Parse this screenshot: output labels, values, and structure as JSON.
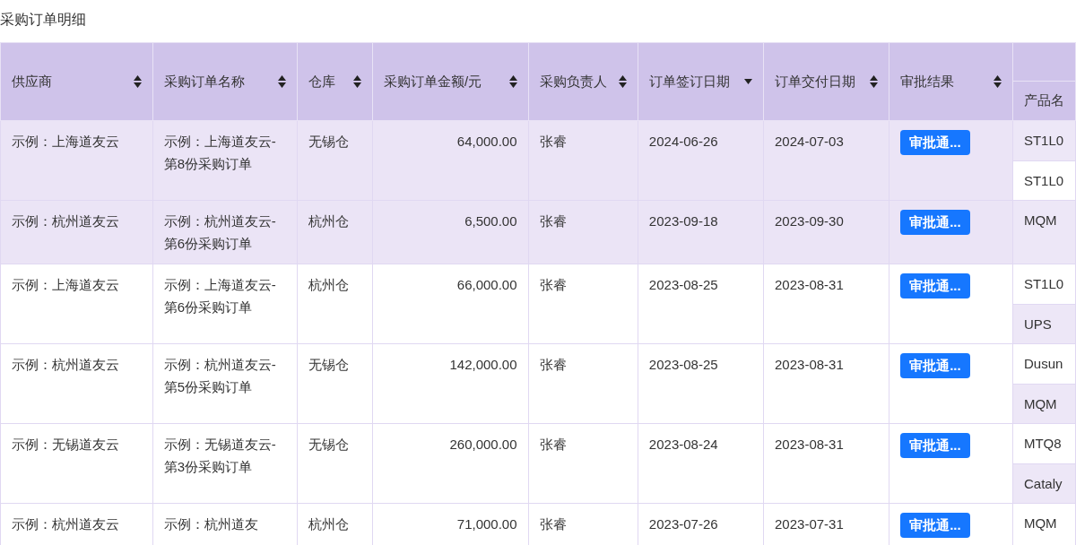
{
  "title": "采购订单明细",
  "table": {
    "columns": [
      {
        "label": "供应商",
        "sorted": false
      },
      {
        "label": "采购订单名称",
        "sorted": false
      },
      {
        "label": "仓库",
        "sorted": false
      },
      {
        "label": "采购订单金额/元",
        "sorted": false
      },
      {
        "label": "采购负责人",
        "sorted": false
      },
      {
        "label": "订单签订日期",
        "sorted": true
      },
      {
        "label": "订单交付日期",
        "sorted": false
      },
      {
        "label": "审批结果",
        "sorted": false
      }
    ],
    "product_group": {
      "subcolumns": [
        "产品名"
      ]
    },
    "rows": [
      {
        "highlighted": true,
        "supplier": "示例：上海道友云",
        "order_name": "示例：上海道友云-第8份采购订单",
        "warehouse": "无锡仓",
        "amount": "64,000.00",
        "owner": "张睿",
        "sign_date": "2024-06-26",
        "delivery_date": "2024-07-03",
        "approval": "审批通...",
        "products": [
          {
            "name": "ST1L0",
            "shaded": true
          },
          {
            "name": "ST1L0",
            "shaded": false
          }
        ]
      },
      {
        "highlighted": true,
        "supplier": "示例：杭州道友云",
        "order_name": "示例：杭州道友云-第6份采购订单",
        "warehouse": "杭州仓",
        "amount": "6,500.00",
        "owner": "张睿",
        "sign_date": "2023-09-18",
        "delivery_date": "2023-09-30",
        "approval": "审批通...",
        "products": [
          {
            "name": "MQM",
            "shaded": true
          }
        ]
      },
      {
        "highlighted": false,
        "supplier": "示例：上海道友云",
        "order_name": "示例：上海道友云-第6份采购订单",
        "warehouse": "杭州仓",
        "amount": "66,000.00",
        "owner": "张睿",
        "sign_date": "2023-08-25",
        "delivery_date": "2023-08-31",
        "approval": "审批通...",
        "products": [
          {
            "name": "ST1L0",
            "shaded": false
          },
          {
            "name": "UPS",
            "shaded": true
          }
        ]
      },
      {
        "highlighted": false,
        "supplier": "示例：杭州道友云",
        "order_name": "示例：杭州道友云-第5份采购订单",
        "warehouse": "无锡仓",
        "amount": "142,000.00",
        "owner": "张睿",
        "sign_date": "2023-08-25",
        "delivery_date": "2023-08-31",
        "approval": "审批通...",
        "products": [
          {
            "name": "Dusun",
            "shaded": false
          },
          {
            "name": "MQM",
            "shaded": true
          }
        ]
      },
      {
        "highlighted": false,
        "supplier": "示例：无锡道友云",
        "order_name": "示例：无锡道友云-第3份采购订单",
        "warehouse": "无锡仓",
        "amount": "260,000.00",
        "owner": "张睿",
        "sign_date": "2023-08-24",
        "delivery_date": "2023-08-31",
        "approval": "审批通...",
        "products": [
          {
            "name": "MTQ8",
            "shaded": false
          },
          {
            "name": "Cataly",
            "shaded": true
          }
        ]
      },
      {
        "highlighted": false,
        "supplier": "示例：杭州道友云",
        "order_name": "示例：杭州道友",
        "warehouse": "杭州仓",
        "amount": "71,000.00",
        "owner": "张睿",
        "sign_date": "2023-07-26",
        "delivery_date": "2023-07-31",
        "approval": "审批通...",
        "products": [
          {
            "name": "MQM",
            "shaded": false
          }
        ]
      }
    ]
  }
}
